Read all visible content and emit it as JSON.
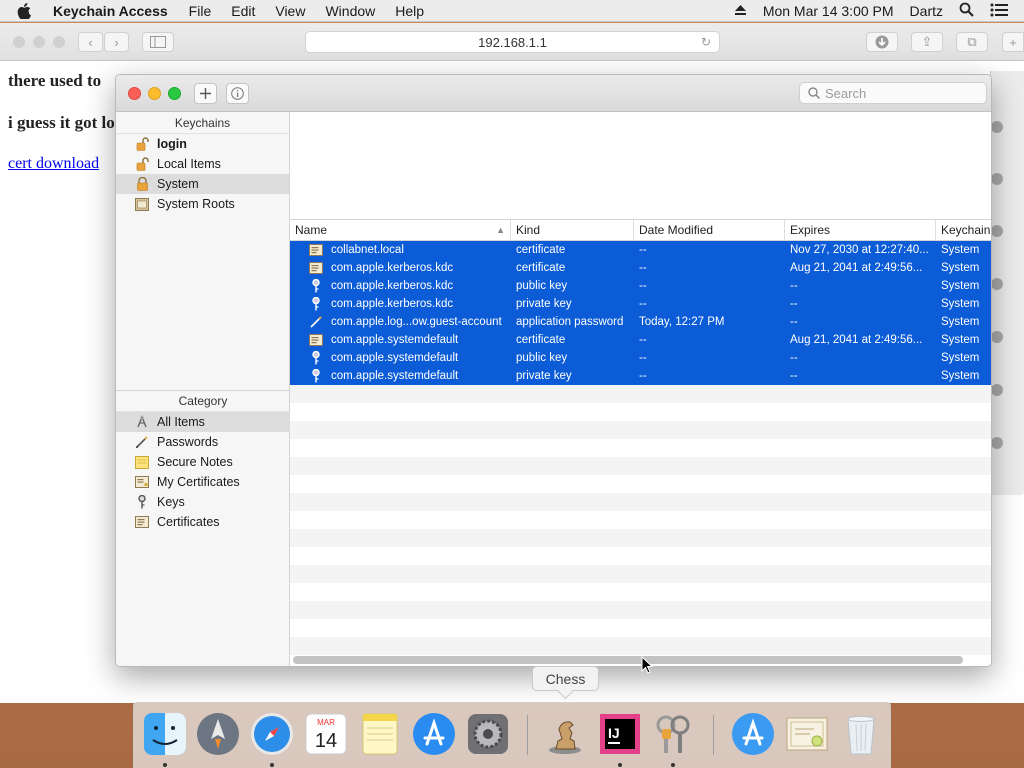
{
  "menubar": {
    "app_name": "Keychain Access",
    "items": [
      "File",
      "Edit",
      "View",
      "Window",
      "Help"
    ],
    "clock": "Mon Mar 14  3:00 PM",
    "user": "Dartz"
  },
  "safari": {
    "url": "192.168.1.1",
    "heading1": "there used to",
    "heading2": "i guess it got los",
    "link_text": "cert download"
  },
  "keychain": {
    "search_placeholder": "Search",
    "keychains_header": "Keychains",
    "keychains": [
      {
        "label": "login",
        "icon": "lock-open-icon"
      },
      {
        "label": "Local Items",
        "icon": "lock-open-icon"
      },
      {
        "label": "System",
        "icon": "lock-open-icon"
      },
      {
        "label": "System Roots",
        "icon": "cabinet-icon"
      }
    ],
    "category_header": "Category",
    "categories": [
      {
        "label": "All Items",
        "icon": "all-items-icon"
      },
      {
        "label": "Passwords",
        "icon": "pen-icon"
      },
      {
        "label": "Secure Notes",
        "icon": "note-icon"
      },
      {
        "label": "My Certificates",
        "icon": "my-certificate-icon"
      },
      {
        "label": "Keys",
        "icon": "key-icon"
      },
      {
        "label": "Certificates",
        "icon": "certificate-icon"
      }
    ],
    "columns": [
      "Name",
      "Kind",
      "Date Modified",
      "Expires",
      "Keychain"
    ],
    "rows": [
      {
        "name": "collabnet.local",
        "kind": "certificate",
        "modified": "--",
        "expires": "Nov 27, 2030 at 12:27:40...",
        "keychain": "System",
        "icon": "certificate-icon"
      },
      {
        "name": "com.apple.kerberos.kdc",
        "kind": "certificate",
        "modified": "--",
        "expires": "Aug 21, 2041 at 2:49:56...",
        "keychain": "System",
        "icon": "certificate-icon"
      },
      {
        "name": "com.apple.kerberos.kdc",
        "kind": "public key",
        "modified": "--",
        "expires": "--",
        "keychain": "System",
        "icon": "key-icon"
      },
      {
        "name": "com.apple.kerberos.kdc",
        "kind": "private key",
        "modified": "--",
        "expires": "--",
        "keychain": "System",
        "icon": "key-icon"
      },
      {
        "name": "com.apple.log...ow.guest-account",
        "kind": "application password",
        "modified": "Today, 12:27 PM",
        "expires": "--",
        "keychain": "System",
        "icon": "pen-icon"
      },
      {
        "name": "com.apple.systemdefault",
        "kind": "certificate",
        "modified": "--",
        "expires": "Aug 21, 2041 at 2:49:56...",
        "keychain": "System",
        "icon": "certificate-icon"
      },
      {
        "name": "com.apple.systemdefault",
        "kind": "public key",
        "modified": "--",
        "expires": "--",
        "keychain": "System",
        "icon": "key-icon"
      },
      {
        "name": "com.apple.systemdefault",
        "kind": "private key",
        "modified": "--",
        "expires": "--",
        "keychain": "System",
        "icon": "key-icon"
      }
    ]
  },
  "tooltip": "Chess",
  "dock": {
    "items": [
      "finder-icon",
      "launchpad-icon",
      "safari-icon",
      "calendar-icon",
      "notes-icon",
      "app-store-icon",
      "system-preferences-icon",
      "chess-icon",
      "intellij-icon",
      "keychain-access-icon",
      "app-store-downloads-icon",
      "certificate-file-icon",
      "trash-icon"
    ],
    "calendar_month": "MAR",
    "calendar_day": "14",
    "intellij_text": "IJ"
  },
  "colors": {
    "selection": "#0b5cd6",
    "close": "#fc5f57",
    "minimize": "#fdbc2e",
    "zoom": "#28c840"
  }
}
